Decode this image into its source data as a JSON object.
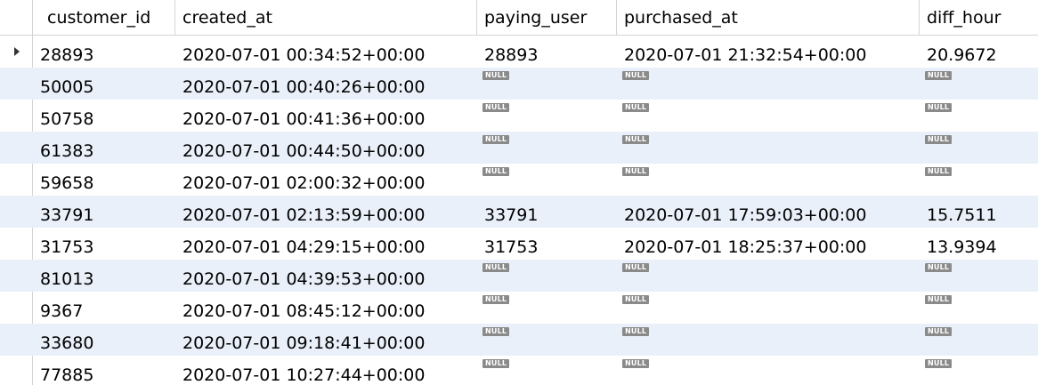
{
  "columns": [
    "customer_id",
    "created_at",
    "paying_user",
    "purchased_at",
    "diff_hour"
  ],
  "null_label": "NULL",
  "rows": [
    {
      "customer_id": "28893",
      "created_at": "2020-07-01 00:34:52+00:00",
      "paying_user": "28893",
      "purchased_at": "2020-07-01 21:32:54+00:00",
      "diff_hour": "20.9672",
      "selected": true
    },
    {
      "customer_id": "50005",
      "created_at": "2020-07-01 00:40:26+00:00",
      "paying_user": null,
      "purchased_at": null,
      "diff_hour": null
    },
    {
      "customer_id": "50758",
      "created_at": "2020-07-01 00:41:36+00:00",
      "paying_user": null,
      "purchased_at": null,
      "diff_hour": null
    },
    {
      "customer_id": "61383",
      "created_at": "2020-07-01 00:44:50+00:00",
      "paying_user": null,
      "purchased_at": null,
      "diff_hour": null
    },
    {
      "customer_id": "59658",
      "created_at": "2020-07-01 02:00:32+00:00",
      "paying_user": null,
      "purchased_at": null,
      "diff_hour": null
    },
    {
      "customer_id": "33791",
      "created_at": "2020-07-01 02:13:59+00:00",
      "paying_user": "33791",
      "purchased_at": "2020-07-01 17:59:03+00:00",
      "diff_hour": "15.7511"
    },
    {
      "customer_id": "31753",
      "created_at": "2020-07-01 04:29:15+00:00",
      "paying_user": "31753",
      "purchased_at": "2020-07-01 18:25:37+00:00",
      "diff_hour": "13.9394"
    },
    {
      "customer_id": "81013",
      "created_at": "2020-07-01 04:39:53+00:00",
      "paying_user": null,
      "purchased_at": null,
      "diff_hour": null
    },
    {
      "customer_id": "9367",
      "created_at": "2020-07-01 08:45:12+00:00",
      "paying_user": null,
      "purchased_at": null,
      "diff_hour": null
    },
    {
      "customer_id": "33680",
      "created_at": "2020-07-01 09:18:41+00:00",
      "paying_user": null,
      "purchased_at": null,
      "diff_hour": null
    },
    {
      "customer_id": "77885",
      "created_at": "2020-07-01 10:27:44+00:00",
      "paying_user": null,
      "purchased_at": null,
      "diff_hour": null
    }
  ],
  "colors": {
    "alt_row": "#eaf0fa",
    "grid_line": "#d4d4d4",
    "null_badge": "#8a8a8a"
  },
  "icons": {
    "current_row": "row-pointer-icon"
  }
}
